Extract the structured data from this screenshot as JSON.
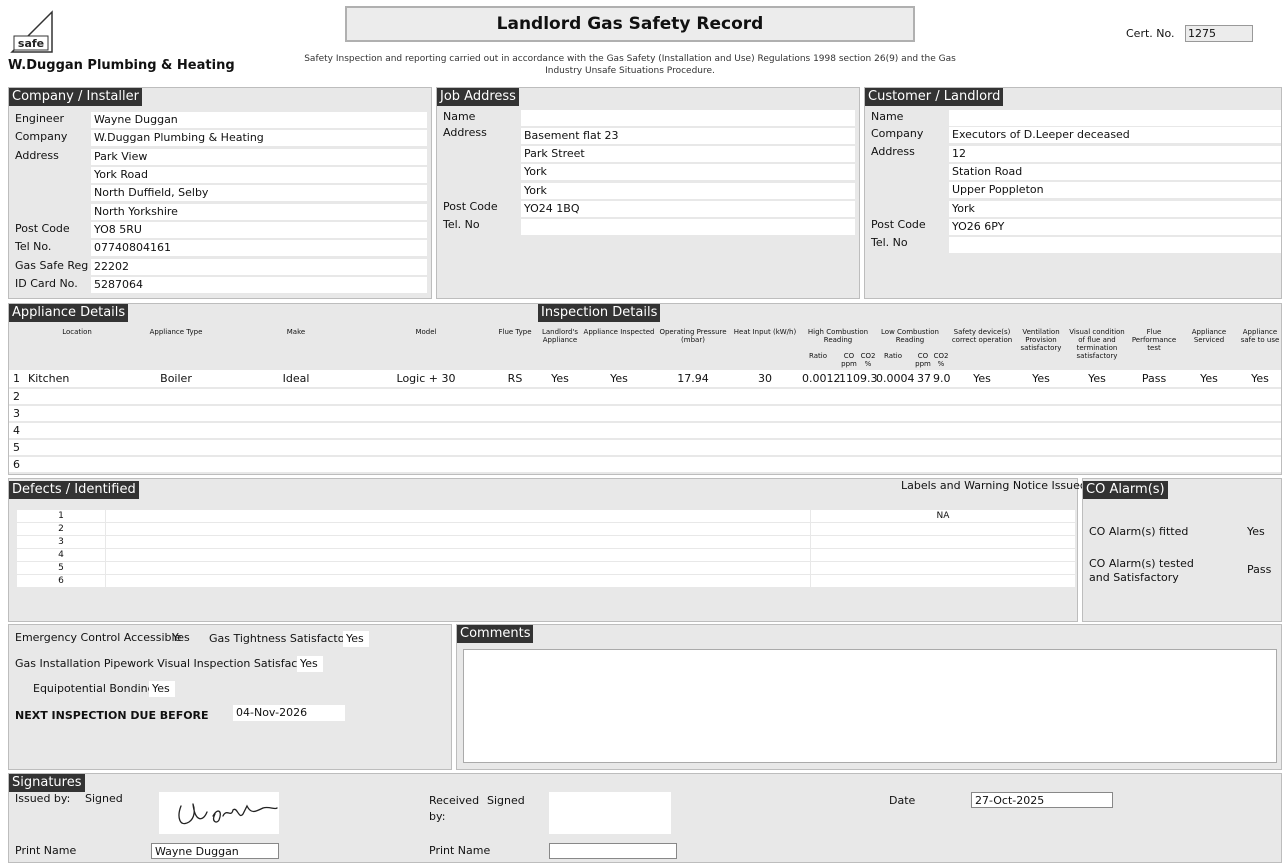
{
  "header": {
    "logo_text": "Gas Safe Register",
    "company_name": "W.Duggan Plumbing & Heating",
    "title": "Landlord Gas Safety Record",
    "subtitle_line1": "Safety Inspection and reporting carried out in accordance with the Gas Safety (Installation and Use) Regulations 1998 section 26(9) and the Gas",
    "subtitle_line2": "Industry Unsafe Situations Procedure.",
    "cert_label": "Cert. No.",
    "cert_no": "1275"
  },
  "installer": {
    "heading": "Company / Installer",
    "engineer_label": "Engineer",
    "engineer": "Wayne Duggan",
    "company_label": "Company",
    "company": "W.Duggan Plumbing & Heating",
    "address_label": "Address",
    "address": [
      "Park View",
      "York Road",
      "North Duffield, Selby",
      "North Yorkshire"
    ],
    "postcode_label": "Post Code",
    "postcode": "YO8 5RU",
    "tel_label": "Tel No.",
    "tel": "07740804161",
    "gassafe_label": "Gas Safe Reg",
    "gassafe": "22202",
    "idcard_label": "ID Card No.",
    "idcard": "5287064"
  },
  "job": {
    "heading": "Job Address",
    "name_label": "Name",
    "name": "",
    "address_label": "Address",
    "address": [
      "Basement flat 23",
      "Park Street",
      "York",
      "York"
    ],
    "postcode_label": "Post Code",
    "postcode": "YO24 1BQ",
    "tel_label": "Tel. No",
    "tel": ""
  },
  "customer": {
    "heading": "Customer / Landlord",
    "name_label": "Name",
    "name": "",
    "company_label": "Company",
    "company": "Executors of D.Leeper deceased",
    "address_label": "Address",
    "address": [
      "12",
      "Station Road",
      "Upper Poppleton",
      "York"
    ],
    "postcode_label": "Post Code",
    "postcode": "YO26 6PY",
    "tel_label": "Tel. No",
    "tel": ""
  },
  "appliances": {
    "heading": "Appliance Details",
    "inspection_heading": "Inspection Details",
    "columns": {
      "location": "Location",
      "type": "Appliance Type",
      "make": "Make",
      "model": "Model",
      "flue": "Flue Type",
      "landlords": "Landlord's Appliance",
      "inspected": "Appliance Inspected",
      "pressure": "Operating Pressure (mbar)",
      "heat": "Heat Input (kW/h)",
      "high": "High Combustion Reading",
      "low": "Low Combustion Reading",
      "ratio": "Ratio",
      "co": "CO ppm",
      "co2": "CO2 %",
      "safety": "Safety device(s) correct operation",
      "vent": "Ventilation Provision satisfactory",
      "visual": "Visual condition of flue and termination satisfactory",
      "flueperf": "Flue Performance test",
      "serviced": "Appliance Serviced",
      "safe": "Appliance safe to use"
    },
    "rows": [
      {
        "num": "1",
        "location": "Kitchen Cupboard",
        "type": "Boiler",
        "make": "Ideal",
        "model": "Logic + 30",
        "flue": "RS",
        "landlords": "Yes",
        "inspected": "Yes",
        "pressure": "17.94",
        "heat": "30",
        "h_ratio": "0.0012",
        "h_co": "110",
        "h_co2": "9.3",
        "l_ratio": "0.0004",
        "l_co": "37",
        "l_co2": "9.0",
        "safety": "Yes",
        "vent": "Yes",
        "visual": "Yes",
        "flueperf": "Pass",
        "serviced": "Yes",
        "safe": "Yes"
      },
      {
        "num": "2"
      },
      {
        "num": "3"
      },
      {
        "num": "4"
      },
      {
        "num": "5"
      },
      {
        "num": "6"
      }
    ]
  },
  "defects": {
    "heading": "Defects / Identified",
    "labels_heading": "Labels and Warning Notice Issued",
    "rows": [
      {
        "num": "1",
        "text": "",
        "notice": "NA"
      },
      {
        "num": "2",
        "text": "",
        "notice": ""
      },
      {
        "num": "3",
        "text": "",
        "notice": ""
      },
      {
        "num": "4",
        "text": "",
        "notice": ""
      },
      {
        "num": "5",
        "text": "",
        "notice": ""
      },
      {
        "num": "6",
        "text": "",
        "notice": ""
      }
    ]
  },
  "co_alarm": {
    "heading": "CO Alarm(s)",
    "fitted_label": "CO Alarm(s) fitted",
    "fitted": "Yes",
    "tested_label_1": "CO Alarm(s) tested",
    "tested_label_2": "and Satisfactory",
    "tested": "Pass"
  },
  "checks": {
    "emergency_label": "Emergency Control Accessible",
    "emergency": "Yes",
    "tightness_label": "Gas Tightness Satisfactory",
    "tightness": "Yes",
    "pipework_label": "Gas Installation Pipework Visual Inspection Satisfactory",
    "pipework": "Yes",
    "bonding_label": "Equipotential Bonding",
    "bonding": "Yes",
    "next_label": "NEXT INSPECTION DUE BEFORE",
    "next": "04-Nov-2026"
  },
  "comments": {
    "heading": "Comments",
    "text": ""
  },
  "signatures": {
    "heading": "Signatures",
    "issued_label": "Issued by:",
    "signed_label": "Signed",
    "received_label_1": "Received",
    "received_label_2": "by:",
    "received_signed_label": "Signed",
    "date_label": "Date",
    "date": "27-Oct-2025",
    "print_label": "Print Name",
    "issued_name": "Wayne Duggan",
    "received_print_label": "Print Name",
    "received_name": ""
  }
}
